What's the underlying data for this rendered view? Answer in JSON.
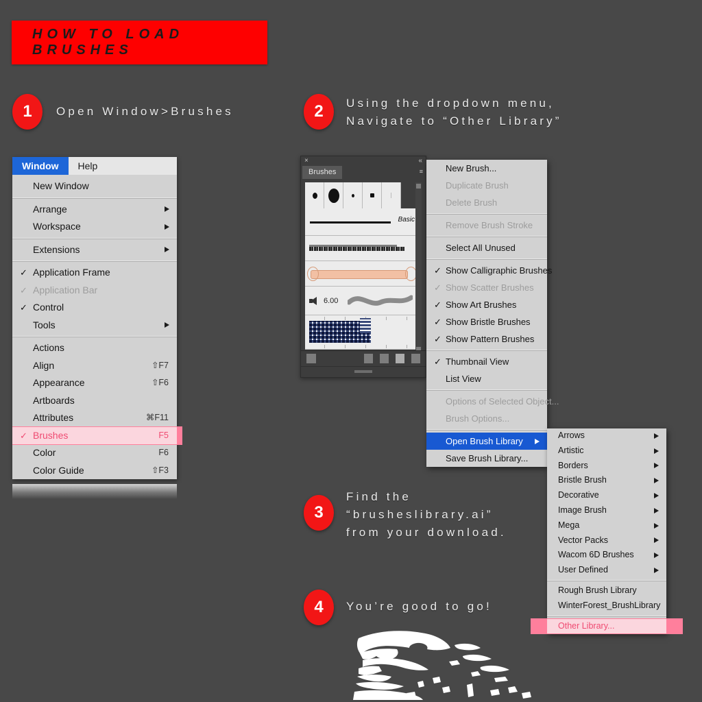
{
  "page": {
    "background_color": "#484848",
    "title": "HOW TO LOAD BRUSHES",
    "accent_red": "#fe0000",
    "badge_red": "#f21616",
    "highlight_pink": "#ff7f9c",
    "menu_blue": "#1859d2"
  },
  "steps": [
    {
      "number": "1",
      "text": "Open Window>Brushes"
    },
    {
      "number": "2",
      "text": "Using the dropdown menu,\nNavigate to “Other Library”"
    },
    {
      "number": "3",
      "text": "Find the\n“brusheslibrary.ai”\nfrom your download."
    },
    {
      "number": "4",
      "text": "You’re good to go!"
    }
  ],
  "window_menu": {
    "menubar": [
      {
        "label": "Window",
        "active": true
      },
      {
        "label": "Help",
        "active": false
      }
    ],
    "items": [
      {
        "label": "New Window",
        "shortcut": "",
        "check": "",
        "arrow": false,
        "disabled": false,
        "highlight": false
      },
      {
        "separator": true
      },
      {
        "label": "Arrange",
        "shortcut": "",
        "check": "",
        "arrow": true,
        "disabled": false,
        "highlight": false
      },
      {
        "label": "Workspace",
        "shortcut": "",
        "check": "",
        "arrow": true,
        "disabled": false,
        "highlight": false
      },
      {
        "separator": true
      },
      {
        "label": "Extensions",
        "shortcut": "",
        "check": "",
        "arrow": true,
        "disabled": false,
        "highlight": false
      },
      {
        "separator": true
      },
      {
        "label": "Application Frame",
        "shortcut": "",
        "check": "✓",
        "arrow": false,
        "disabled": false,
        "highlight": false
      },
      {
        "label": "Application Bar",
        "shortcut": "",
        "check": "✓",
        "arrow": false,
        "disabled": true,
        "highlight": false
      },
      {
        "label": "Control",
        "shortcut": "",
        "check": "✓",
        "arrow": false,
        "disabled": false,
        "highlight": false
      },
      {
        "label": "Tools",
        "shortcut": "",
        "check": "",
        "arrow": true,
        "disabled": false,
        "highlight": false
      },
      {
        "separator": true
      },
      {
        "label": "Actions",
        "shortcut": "",
        "check": "",
        "arrow": false,
        "disabled": false,
        "highlight": false
      },
      {
        "label": "Align",
        "shortcut": "⇧F7",
        "check": "",
        "arrow": false,
        "disabled": false,
        "highlight": false
      },
      {
        "label": "Appearance",
        "shortcut": "⇧F6",
        "check": "",
        "arrow": false,
        "disabled": false,
        "highlight": false
      },
      {
        "label": "Artboards",
        "shortcut": "",
        "check": "",
        "arrow": false,
        "disabled": false,
        "highlight": false
      },
      {
        "label": "Attributes",
        "shortcut": "⌘F11",
        "check": "",
        "arrow": false,
        "disabled": false,
        "highlight": false
      },
      {
        "label": "Brushes",
        "shortcut": "F5",
        "check": "✓",
        "arrow": false,
        "disabled": false,
        "highlight": true
      },
      {
        "label": "Color",
        "shortcut": "F6",
        "check": "",
        "arrow": false,
        "disabled": false,
        "highlight": false
      },
      {
        "label": "Color Guide",
        "shortcut": "⇧F3",
        "check": "",
        "arrow": false,
        "disabled": false,
        "highlight": false
      }
    ]
  },
  "brushes_panel": {
    "close_icon": "×",
    "collapse_icon": "«",
    "tab_label": "Brushes",
    "panel_menu_icon": "≡",
    "basic_label": "Basic",
    "size_value": "6.00"
  },
  "context_menu": {
    "items": [
      {
        "label": "New Brush...",
        "check": "",
        "arrow": false,
        "disabled": false,
        "selected": false
      },
      {
        "label": "Duplicate Brush",
        "check": "",
        "arrow": false,
        "disabled": true,
        "selected": false
      },
      {
        "label": "Delete Brush",
        "check": "",
        "arrow": false,
        "disabled": true,
        "selected": false
      },
      {
        "separator": true
      },
      {
        "label": "Remove Brush Stroke",
        "check": "",
        "arrow": false,
        "disabled": true,
        "selected": false
      },
      {
        "separator": true
      },
      {
        "label": "Select All Unused",
        "check": "",
        "arrow": false,
        "disabled": false,
        "selected": false
      },
      {
        "separator": true
      },
      {
        "label": "Show Calligraphic Brushes",
        "check": "✓",
        "arrow": false,
        "disabled": false,
        "selected": false
      },
      {
        "label": "Show Scatter Brushes",
        "check": "✓",
        "arrow": false,
        "disabled": true,
        "selected": false
      },
      {
        "label": "Show Art Brushes",
        "check": "✓",
        "arrow": false,
        "disabled": false,
        "selected": false
      },
      {
        "label": "Show Bristle Brushes",
        "check": "✓",
        "arrow": false,
        "disabled": false,
        "selected": false
      },
      {
        "label": "Show Pattern Brushes",
        "check": "✓",
        "arrow": false,
        "disabled": false,
        "selected": false
      },
      {
        "separator": true
      },
      {
        "label": "Thumbnail View",
        "check": "✓",
        "arrow": false,
        "disabled": false,
        "selected": false
      },
      {
        "label": "List View",
        "check": "",
        "arrow": false,
        "disabled": false,
        "selected": false
      },
      {
        "separator": true
      },
      {
        "label": "Options of Selected Object...",
        "check": "",
        "arrow": false,
        "disabled": true,
        "selected": false
      },
      {
        "label": "Brush Options...",
        "check": "",
        "arrow": false,
        "disabled": true,
        "selected": false
      },
      {
        "separator": true
      },
      {
        "label": "Open Brush Library",
        "check": "",
        "arrow": true,
        "disabled": false,
        "selected": true
      },
      {
        "label": "Save Brush Library...",
        "check": "",
        "arrow": false,
        "disabled": false,
        "selected": false
      }
    ]
  },
  "submenu": {
    "items": [
      {
        "label": "Arrows",
        "arrow": true,
        "highlight": false
      },
      {
        "label": "Artistic",
        "arrow": true,
        "highlight": false
      },
      {
        "label": "Borders",
        "arrow": true,
        "highlight": false
      },
      {
        "label": "Bristle Brush",
        "arrow": true,
        "highlight": false
      },
      {
        "label": "Decorative",
        "arrow": true,
        "highlight": false
      },
      {
        "label": "Image Brush",
        "arrow": true,
        "highlight": false
      },
      {
        "label": "Mega",
        "arrow": true,
        "highlight": false
      },
      {
        "label": "Vector Packs",
        "arrow": true,
        "highlight": false
      },
      {
        "label": "Wacom 6D Brushes",
        "arrow": true,
        "highlight": false
      },
      {
        "label": "User Defined",
        "arrow": true,
        "highlight": false
      },
      {
        "separator": true
      },
      {
        "label": "Rough Brush Library",
        "arrow": false,
        "highlight": false
      },
      {
        "label": "WinterForest_BrushLibrary",
        "arrow": false,
        "highlight": false
      },
      {
        "separator": true
      },
      {
        "label": "Other Library...",
        "arrow": false,
        "highlight": true
      }
    ]
  }
}
